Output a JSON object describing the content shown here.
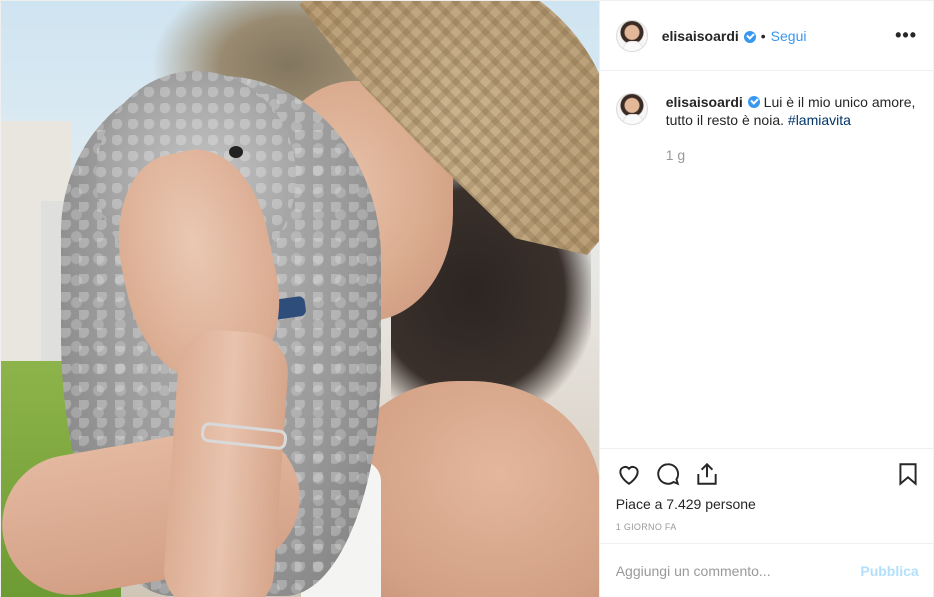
{
  "post": {
    "header": {
      "username": "elisaisoardi",
      "dot": "•",
      "follow_label": "Segui",
      "more_label": "•••"
    },
    "caption": {
      "username": "elisaisoardi",
      "text": "Lui è il mio unico amore, tutto il resto è noia.",
      "hashtag": "#lamiavita",
      "age": "1 g"
    },
    "actions": {
      "like_icon": "heart-icon",
      "comment_icon": "comment-icon",
      "share_icon": "share-icon",
      "save_icon": "bookmark-icon"
    },
    "likes_text": "Piace a 7.429 persone",
    "date_text": "1 GIORNO FA",
    "composer": {
      "placeholder": "Aggiungi un commento...",
      "publish_label": "Pubblica"
    },
    "colors": {
      "accent": "#3897f0",
      "hashtag": "#003569",
      "muted": "#999999",
      "publish_disabled": "#b2dffc"
    }
  }
}
